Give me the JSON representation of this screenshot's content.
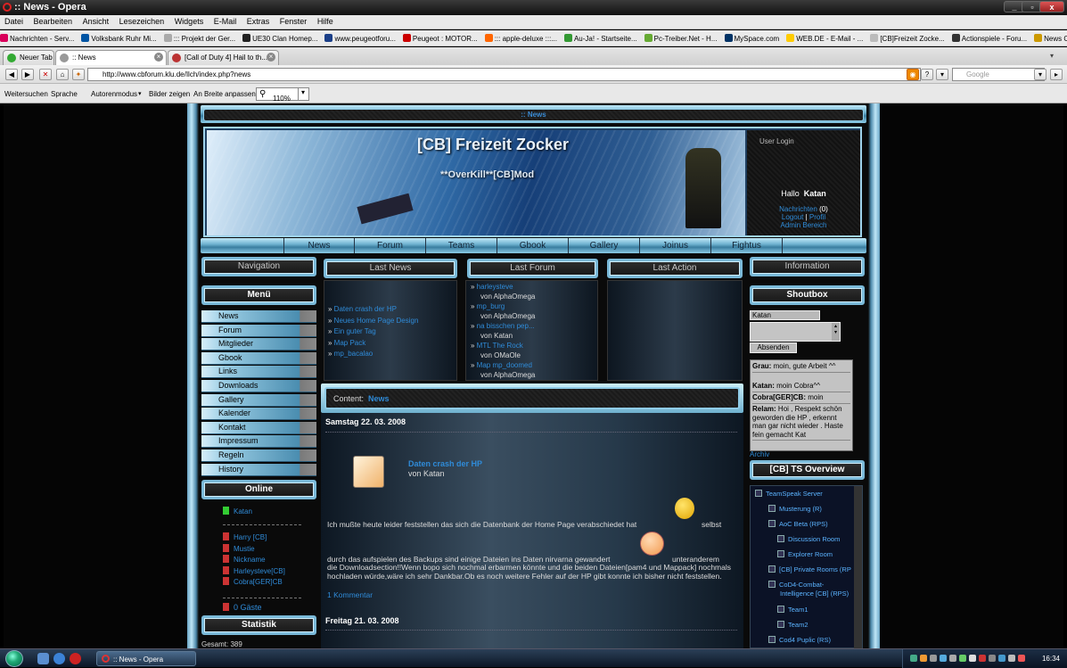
{
  "window": {
    "title": ":: News - Opera",
    "buttons": [
      "_",
      "▫",
      "x"
    ]
  },
  "menu": [
    "Datei",
    "Bearbeiten",
    "Ansicht",
    "Lesezeichen",
    "Widgets",
    "E-Mail",
    "Extras",
    "Fenster",
    "Hilfe"
  ],
  "bookmarks": [
    {
      "label": "Nachrichten - Serv...",
      "color": "#d9005b"
    },
    {
      "label": "Volksbank Ruhr Mi...",
      "color": "#0055a4"
    },
    {
      "label": "::: Projekt der Ger...",
      "color": "#aaa"
    },
    {
      "label": "UE30 Clan Homep...",
      "color": "#222"
    },
    {
      "label": "www.peugeotforu...",
      "color": "#1b3f88"
    },
    {
      "label": "Peugeot : MOTOR...",
      "color": "#c00"
    },
    {
      "label": "::: apple-deluxe :::...",
      "color": "#f60"
    },
    {
      "label": "Au-Ja! - Startseite...",
      "color": "#393"
    },
    {
      "label": "Pc-Treiber.Net - H...",
      "color": "#6a3"
    },
    {
      "label": "MySpace.com",
      "color": "#036"
    },
    {
      "label": "WEB.DE - E-Mail - ...",
      "color": "#fc0"
    },
    {
      "label": "[CB]Freizeit Zocke...",
      "color": "#bbb"
    },
    {
      "label": "Actionspiele - Foru...",
      "color": "#333"
    },
    {
      "label": "News CoD4 Maps :...",
      "color": "#c90"
    }
  ],
  "tabs": [
    {
      "label": "Neuer Tab",
      "icon_color": "#3a3"
    },
    {
      "label": ":: News",
      "icon_color": "#999"
    },
    {
      "label": "[Call of Duty 4] Hail to th...",
      "icon_color": "#b33"
    }
  ],
  "address": {
    "url": "http://www.cbforum.klu.de/Ilch/index.php?news",
    "search_placeholder": "Google"
  },
  "viewbar": {
    "items": [
      "Weitersuchen",
      "Sprache",
      "Autorenmodus",
      "Bilder zeigen",
      "An Breite anpassen"
    ],
    "zoom": "110%"
  },
  "site": {
    "top_title": ":: News",
    "banner_title": "[CB] Freizeit Zocker",
    "banner_sub": "**OverKill**[CB]Mod",
    "login": {
      "heading": "User Login",
      "hello": "Hallo",
      "user": "Katan",
      "messages": "Nachrichten",
      "count": "(0)",
      "logout": "Logout",
      "sep": "|",
      "profile": "Profil",
      "admin": "Admin Bereich"
    },
    "topmenu": [
      "News",
      "Forum",
      "Teams",
      "Gbook",
      "Gallery",
      "Joinus",
      "Fightus"
    ],
    "nav_heading": "Navigation",
    "menu_heading": "Menü",
    "nav_items": [
      "News",
      "Forum",
      "Mitglieder",
      "Gbook",
      "Links",
      "Downloads",
      "Gallery",
      "Kalender",
      "Kontakt",
      "Impressum",
      "Regeln",
      "History"
    ],
    "online_heading": "Online",
    "online_self": "Katan",
    "online_users": [
      "Harry [CB]",
      "Mustie",
      "Nickname",
      "Harleysteve[CB]",
      "Cobra[GER]CB"
    ],
    "guests": "0 Gäste",
    "stats_heading": "Statistik",
    "stats_total": "Gesamt: 389",
    "last_news_heading": "Last News",
    "last_news": [
      "Daten crash der HP",
      "Neues Home Page Design",
      "Ein guter Tag",
      "Map Pack",
      "mp_bacalao"
    ],
    "last_forum_heading": "Last Forum",
    "last_forum": [
      {
        "topic": "harleysteve",
        "by": "von AlphaOmega"
      },
      {
        "topic": "mp_burg",
        "by": "von AlphaOmega"
      },
      {
        "topic": "na bisschen pep...",
        "by": "von Katan"
      },
      {
        "topic": "MTL The Rock",
        "by": "von OMaOle"
      },
      {
        "topic": "Map mp_doomed",
        "by": "von AlphaOmega"
      }
    ],
    "last_action_heading": "Last Action",
    "content_label": "Content:",
    "content_value": "News",
    "news": [
      {
        "date": "Samstag 22. 03. 2008",
        "title": "Daten crash der HP",
        "author": "von Katan",
        "line1": "Ich mußte heute leider feststellen das sich die Datenbank der Home Page verabschiedet hat",
        "line1b": "selbst",
        "line2a": "durch das aufspielen des Backups sind einige Dateien ins Daten nirvarna gewandert",
        "line2b": "unteranderem",
        "body": "die Downloadsection!!Wenn bopo sich nochmal erbarmen könnte und die beiden Dateien[pam4 und Mappack] nochmals hochladen würde,wäre ich sehr Dankbar.Ob es noch weitere Fehler auf der HP gibt konnte ich bisher nicht feststellen.",
        "comments": "1 Kommentar"
      },
      {
        "date": "Freitag 21. 03. 2008"
      }
    ],
    "info_heading": "Information",
    "shoutbox_heading": "Shoutbox",
    "shout_name": "Katan",
    "shout_submit": "Absenden",
    "shouts": [
      {
        "who": "Grau:",
        "msg": "moin, gute Arbeit ^^"
      },
      {
        "who": "Katan:",
        "msg": "moin Cobra^^"
      },
      {
        "who": "Cobra[GER]CB:",
        "msg": "moin"
      },
      {
        "who": "Relam:",
        "msg": "Hoi , Respekt schön geworden die HP , erkennt man gar nicht wieder . Haste fein gemacht Kat"
      }
    ],
    "archive": "Archiv",
    "ts_heading": "[CB] TS Overview",
    "ts_tree": [
      "TeamSpeak Server",
      "Musterung (R)",
      "AoC Beta (RPS)",
      "Discussion Room",
      "Explorer Room",
      "[CB] Private Rooms (RP",
      "CoD4-Combat-",
      "Intelligence [CB] (RPS)",
      "Team1",
      "Team2",
      "Cod4 Puplic (RS)"
    ]
  },
  "taskbar": {
    "task": ":: News - Opera",
    "clock": "16:34"
  }
}
